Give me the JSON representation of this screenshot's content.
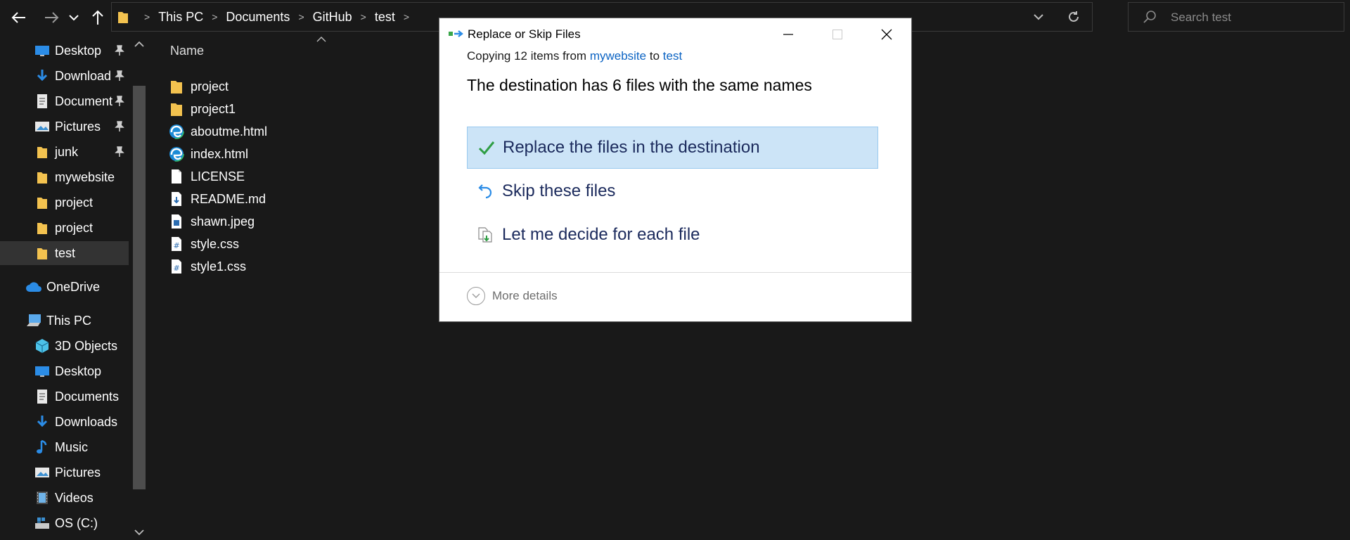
{
  "address_bar": {
    "breadcrumbs": [
      "This PC",
      "Documents",
      "GitHub",
      "test"
    ],
    "search_placeholder": "Search test"
  },
  "sidebar": {
    "quick_access": [
      {
        "label": "Desktop",
        "icon": "desktop-icon",
        "pinned": true
      },
      {
        "label": "Download",
        "icon": "download-icon",
        "pinned": true
      },
      {
        "label": "Document",
        "icon": "document-icon",
        "pinned": true
      },
      {
        "label": "Pictures",
        "icon": "pictures-icon",
        "pinned": true
      },
      {
        "label": "junk",
        "icon": "folder-icon",
        "pinned": true
      },
      {
        "label": "mywebsite",
        "icon": "folder-icon",
        "pinned": false
      },
      {
        "label": "project",
        "icon": "folder-icon",
        "pinned": false
      },
      {
        "label": "project",
        "icon": "folder-icon",
        "pinned": false
      },
      {
        "label": "test",
        "icon": "folder-icon",
        "pinned": false,
        "selected": true
      }
    ],
    "onedrive": {
      "label": "OneDrive",
      "icon": "cloud-icon"
    },
    "this_pc": {
      "label": "This PC",
      "icon": "computer-icon"
    },
    "this_pc_items": [
      {
        "label": "3D Objects",
        "icon": "cube-icon"
      },
      {
        "label": "Desktop",
        "icon": "desktop-icon"
      },
      {
        "label": "Documents",
        "icon": "document-icon"
      },
      {
        "label": "Downloads",
        "icon": "download-icon"
      },
      {
        "label": "Music",
        "icon": "music-icon"
      },
      {
        "label": "Pictures",
        "icon": "pictures-icon"
      },
      {
        "label": "Videos",
        "icon": "video-icon"
      },
      {
        "label": "OS (C:)",
        "icon": "drive-icon"
      }
    ]
  },
  "file_list": {
    "column_header": "Name",
    "files": [
      {
        "name": "project",
        "icon": "folder-icon"
      },
      {
        "name": "project1",
        "icon": "folder-icon"
      },
      {
        "name": "aboutme.html",
        "icon": "edge-icon"
      },
      {
        "name": "index.html",
        "icon": "edge-icon"
      },
      {
        "name": "LICENSE",
        "icon": "file-icon"
      },
      {
        "name": "README.md",
        "icon": "markdown-file-icon"
      },
      {
        "name": "shawn.jpeg",
        "icon": "image-file-icon"
      },
      {
        "name": "style.css",
        "icon": "css-file-icon"
      },
      {
        "name": "style1.css",
        "icon": "css-file-icon"
      }
    ]
  },
  "dialog": {
    "title": "Replace or Skip Files",
    "copying_prefix": "Copying 12 items from",
    "source": "mywebsite",
    "to_word": "to",
    "destination": "test",
    "headline": "The destination has 6 files with the same names",
    "options": [
      {
        "label": "Replace the files in the destination",
        "icon": "checkmark-icon",
        "selected": true
      },
      {
        "label": "Skip these files",
        "icon": "undo-arrow-icon",
        "selected": false
      },
      {
        "label": "Let me decide for each file",
        "icon": "compare-files-icon",
        "selected": false
      }
    ],
    "more_details": "More details"
  },
  "colors": {
    "explorer_bg": "#191919",
    "selected_option_bg": "#cce4f7",
    "link": "#0b63c3",
    "folder": "#f3c24f"
  }
}
